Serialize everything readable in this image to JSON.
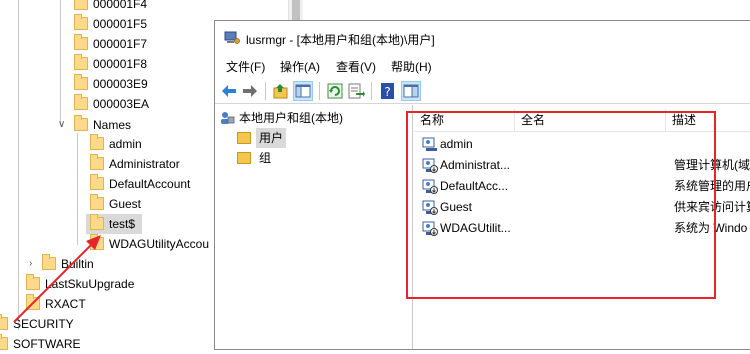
{
  "registry": {
    "items": [
      {
        "label": "000001F4"
      },
      {
        "label": "000001F5"
      },
      {
        "label": "000001F7"
      },
      {
        "label": "000001F8"
      },
      {
        "label": "000003E9"
      },
      {
        "label": "000003EA"
      },
      {
        "label": "Names"
      },
      {
        "label": "admin"
      },
      {
        "label": "Administrator"
      },
      {
        "label": "DefaultAccount"
      },
      {
        "label": "Guest"
      },
      {
        "label": "test$"
      },
      {
        "label": "WDAGUtilityAccou"
      },
      {
        "label": "Builtin"
      },
      {
        "label": "LastSkuUpgrade"
      },
      {
        "label": "RXACT"
      },
      {
        "label": "SECURITY"
      },
      {
        "label": "SOFTWARE"
      }
    ]
  },
  "window": {
    "title": "lusrmgr - [本地用户和组(本地)\\用户]"
  },
  "menu": {
    "items": [
      {
        "label": "文件(F)"
      },
      {
        "label": "操作(A)"
      },
      {
        "label": "查看(V)"
      },
      {
        "label": "帮助(H)"
      }
    ]
  },
  "scope": {
    "root": "本地用户和组(本地)",
    "children": [
      {
        "label": "用户"
      },
      {
        "label": "组"
      }
    ]
  },
  "list": {
    "columns": [
      {
        "label": "名称"
      },
      {
        "label": "全名"
      },
      {
        "label": "描述"
      }
    ],
    "rows": [
      {
        "name": "admin",
        "full_name": "",
        "description": ""
      },
      {
        "name": "Administrat...",
        "full_name": "",
        "description": "管理计算机(域)"
      },
      {
        "name": "DefaultAcc...",
        "full_name": "",
        "description": "系统管理的用户"
      },
      {
        "name": "Guest",
        "full_name": "",
        "description": "供来宾访问计算"
      },
      {
        "name": "WDAGUtilit...",
        "full_name": "",
        "description": "系统为 Windo"
      }
    ]
  },
  "colors": {
    "annotation": "#e8232a",
    "folder": "#fdd98b",
    "selection": "#d9d9d9"
  }
}
